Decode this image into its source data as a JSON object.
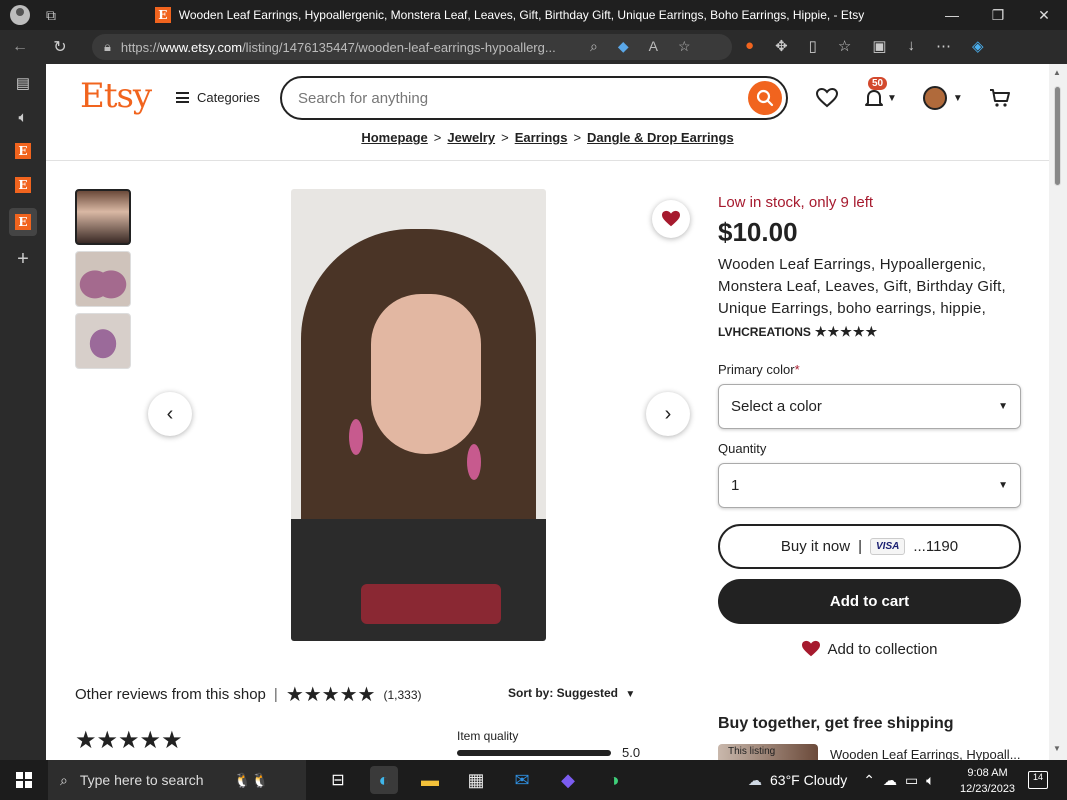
{
  "window": {
    "tab_title": "Wooden Leaf Earrings, Hypoallergenic, Monstera Leaf, Leaves, Gift, Birthday Gift, Unique Earrings, Boho Earrings, Hippie, - Etsy",
    "controls": [
      "—",
      "❐",
      "✕"
    ]
  },
  "address_bar": {
    "url_prefix": "https://",
    "url_host": "www.etsy.com",
    "url_path": "/listing/1476135447/wooden-leaf-earrings-hypoallerg..."
  },
  "header": {
    "logo": "Etsy",
    "categories_label": "Categories",
    "search_placeholder": "Search for anything",
    "notification_count": "50"
  },
  "breadcrumbs": [
    "Homepage",
    "Jewelry",
    "Earrings",
    "Dangle & Drop Earrings"
  ],
  "product": {
    "stock": "Low in stock, only 9 left",
    "price": "$10.00",
    "title": "Wooden Leaf Earrings, Hypoallergenic, Monstera Leaf, Leaves, Gift, Birthday Gift, Unique Earrings, boho earrings, hippie,",
    "shop": "LVHCREATIONS",
    "shop_stars": "★★★★★",
    "primary_color_label": "Primary color",
    "primary_color_required": "*",
    "primary_color_value": "Select a color",
    "quantity_label": "Quantity",
    "quantity_value": "1",
    "buy_now_label": "Buy it now",
    "buy_now_separator": "|",
    "card_brand": "VISA",
    "card_last_digits": "...1190",
    "add_to_cart": "Add to cart",
    "add_to_collection": "Add to collection"
  },
  "buy_together": {
    "heading": "Buy together, get free shipping",
    "thumb_label": "This listing",
    "item_label": "Wooden Leaf Earrings, Hypoall..."
  },
  "reviews": {
    "heading": "Other reviews from this shop",
    "divider": "|",
    "stars": "★★★★★",
    "count": "(1,333)",
    "sort_label": "Sort by: Suggested",
    "review_stars": "★★★★★",
    "item_quality_label": "Item quality",
    "item_quality_value": "5.0"
  },
  "taskbar": {
    "search_placeholder": "Type here to search",
    "weather": "63°F  Cloudy",
    "time": "9:08 AM",
    "date": "12/23/2023",
    "notification_count": "14"
  },
  "colors": {
    "brand": "#f1641e",
    "stock_red": "#a61a2e",
    "dark_button": "#222222"
  }
}
